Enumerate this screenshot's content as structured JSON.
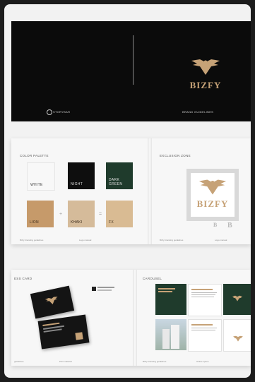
{
  "cover": {
    "brand": "BIZFY",
    "studio": "STORYBAR",
    "guidelines": "BRAND GUIDELINES"
  },
  "palette": {
    "title": "COLOR PALETTE",
    "swatches": [
      {
        "name": "WHITE",
        "color": "#f8f8f8",
        "text": "#444444"
      },
      {
        "name": "NIGHT",
        "color": "#0e0e0e",
        "text": "#dddddd"
      },
      {
        "name": "DARK GREEN",
        "color": "#1f3b2c",
        "text": "#dddddd"
      },
      {
        "name": "LION",
        "color": "#c69a6a",
        "text": "#3a2a1a"
      },
      {
        "name": "KHAKI",
        "color": "#d5bb9a",
        "text": "#3a2a1a"
      },
      {
        "name": "FX",
        "color": "#d9bb93",
        "text": "#3a2a1a"
      }
    ],
    "plus": "+",
    "equals": "=",
    "footer_left": "Bizfy branding guidelines",
    "footer_right": "Logo manual"
  },
  "exclusion": {
    "title": "EXCLUSION ZONE",
    "brand": "BIZFY",
    "ratio_a": "B",
    "ratio_b": "B",
    "footer_left": "Bizfy branding guidelines",
    "footer_right": "Logo manual"
  },
  "cards": {
    "title": "ESS CARD",
    "footer_left": "guidelines",
    "footer_right": "Print material"
  },
  "carousel": {
    "title": "CAROUSEL",
    "footer_left": "Bizfy branding guidelines",
    "footer_right": "Online space"
  },
  "colors": {
    "gold": "#c6a277",
    "night": "#0b0b0b",
    "green": "#1f3b2c"
  }
}
